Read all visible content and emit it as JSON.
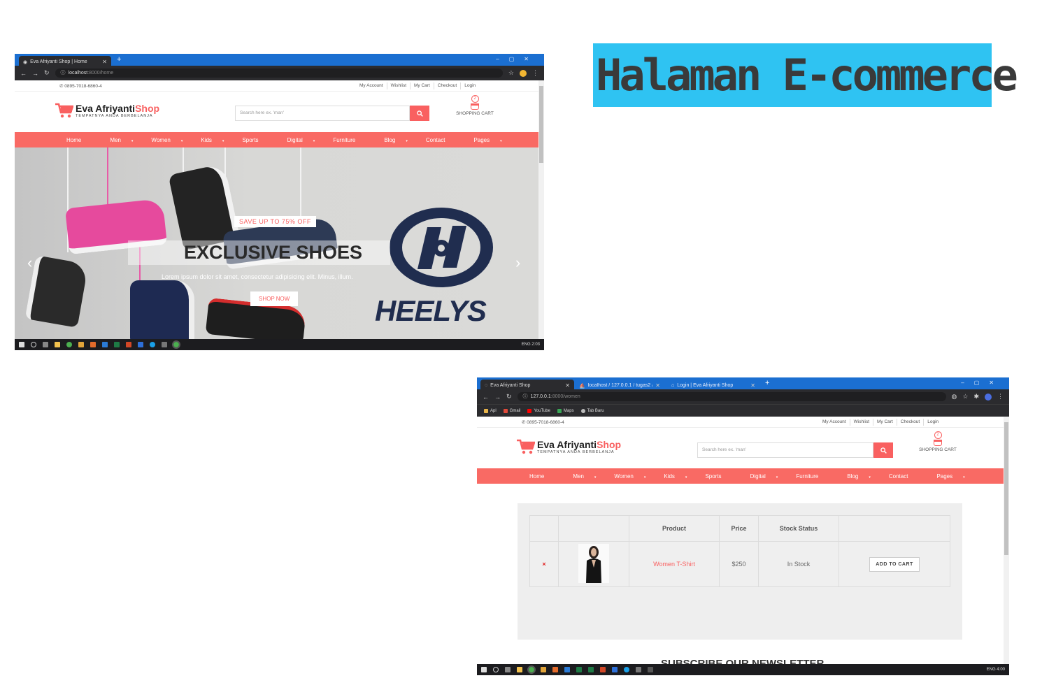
{
  "banner": {
    "title": "Halaman E-commerce"
  },
  "site": {
    "phone": "0895-7018-6860-4",
    "top_links": [
      "My Account",
      "Wishlist",
      "My Cart",
      "Checkout",
      "Login"
    ],
    "logo_name": "Eva Afriyanti",
    "logo_accent": "Shop",
    "tagline": "TEMPATNYA ANDA BERBELANJA",
    "search_placeholder": "Search here ex. 'man'",
    "cart_count": "2",
    "cart_label": "SHOPPING CART",
    "nav": [
      {
        "label": "Home",
        "caret": ""
      },
      {
        "label": "Men",
        "caret": "▾"
      },
      {
        "label": "Women",
        "caret": "▾"
      },
      {
        "label": "Kids",
        "caret": "▾"
      },
      {
        "label": "Sports",
        "caret": ""
      },
      {
        "label": "Digital",
        "caret": "▾"
      },
      {
        "label": "Furniture",
        "caret": ""
      },
      {
        "label": "Blog",
        "caret": "▾"
      },
      {
        "label": "Contact",
        "caret": ""
      },
      {
        "label": "Pages",
        "caret": "▾"
      }
    ],
    "colors": {
      "accent": "#f96060",
      "nav_bg": "#f96a64"
    }
  },
  "window1": {
    "tab_title": "Eva Afriyanti Shop | Home",
    "url_host": "localhost",
    "url_path": ":8000/home",
    "hero": {
      "save_text": "SAVE UP TO 75% OFF",
      "title": "EXCLUSIVE SHOES",
      "lorem": "Lorem ipsum dolor sit amet, consectetur adipisicing elit. Minus, illum.",
      "button": "SHOP NOW",
      "brand": "HEELYS"
    },
    "tray_text": "ENG   2:03"
  },
  "window2": {
    "tabs": [
      "Eva Afriyanti Shop",
      "localhost / 127.0.0.1 / tugas2 / p",
      "Login | Eva Afriyanti Shop"
    ],
    "url_host": "127.0.0.1",
    "url_path": ":8000/women",
    "bookmarks": [
      "Apl",
      "Gmail",
      "YouTube",
      "Maps",
      "Tab Baru"
    ],
    "table": {
      "headers": [
        "",
        "",
        "Product",
        "Price",
        "Stock Status",
        ""
      ],
      "rows": [
        {
          "remove": "×",
          "product": "Women T-Shirt",
          "price": "$250",
          "stock": "In Stock",
          "action": "ADD TO CART"
        }
      ]
    },
    "newsletter": "SUBSCRIBE OUR NEWSLETTER",
    "tray_text": "ENG   4:00"
  }
}
